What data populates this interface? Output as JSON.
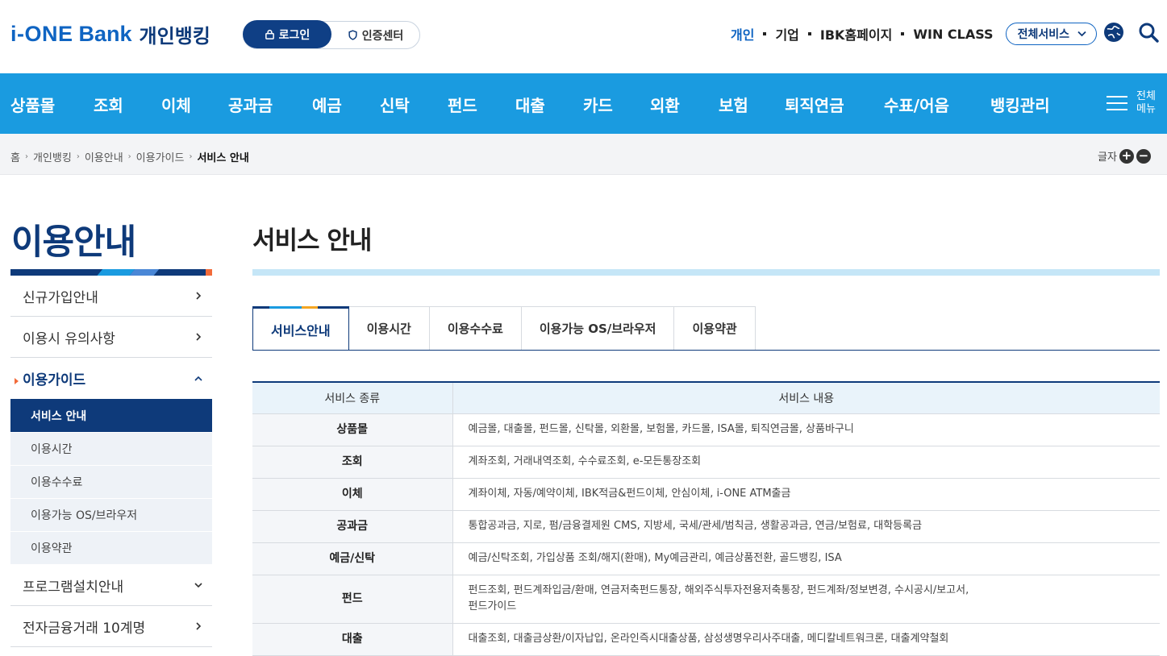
{
  "header": {
    "logo_ione": "i-ONE",
    "logo_bank": "Bank",
    "logo_kr": "개인뱅킹",
    "login_label": "로그인",
    "cert_label": "인증센터",
    "util_nav": [
      "개인",
      "기업",
      "IBK홈페이지",
      "WIN CLASS"
    ],
    "all_services_label": "전체서비스",
    "brand_color": "#0f64c2"
  },
  "gnb": {
    "items": [
      "상품몰",
      "조회",
      "이체",
      "공과금",
      "예금",
      "신탁",
      "펀드",
      "대출",
      "카드",
      "외환",
      "보험",
      "퇴직연금",
      "수표/어음",
      "뱅킹관리"
    ],
    "all_menu_label_1": "전체",
    "all_menu_label_2": "메뉴",
    "bg_color": "#1a9be0"
  },
  "breadcrumb": {
    "items": [
      "홈",
      "개인뱅킹",
      "이용안내",
      "이용가이드"
    ],
    "current": "서비스 안내",
    "font_size_label": "글자"
  },
  "lnb": {
    "title": "이용안내",
    "items": [
      {
        "label": "신규가입안내"
      },
      {
        "label": "이용시 유의사항"
      },
      {
        "label": "이용가이드"
      },
      {
        "label": "프로그램설치안내"
      },
      {
        "label": "전자금융거래 10계명"
      }
    ],
    "sub_items": [
      "서비스 안내",
      "이용시간",
      "이용수수료",
      "이용가능 OS/브라우저",
      "이용약관"
    ]
  },
  "main": {
    "page_title": "서비스 안내",
    "tabs": [
      "서비스안내",
      "이용시간",
      "이용수수료",
      "이용가능 OS/브라우저",
      "이용약관"
    ],
    "table": {
      "headers": [
        "서비스 종류",
        "서비스 내용"
      ],
      "rows": [
        {
          "kind": "상품몰",
          "content": "예금몰, 대출몰, 펀드몰, 신탁몰, 외환몰, 보험몰, 카드몰, ISA몰, 퇴직연금몰, 상품바구니"
        },
        {
          "kind": "조회",
          "content": "계좌조회, 거래내역조회, 수수료조회, e-모든통장조회"
        },
        {
          "kind": "이체",
          "content": "계좌이체, 자동/예약이체, IBK적금&펀드이체, 안심이체, i-ONE ATM출금"
        },
        {
          "kind": "공과금",
          "content": "통합공과금, 지로, 펌/금융결제원 CMS, 지방세, 국세/관세/범칙금, 생활공과금, 연금/보험료, 대학등록금"
        },
        {
          "kind": "예금/신탁",
          "content": "예금/신탁조회, 가입상품 조회/해지(환매), My예금관리, 예금상품전환, 골드뱅킹, ISA"
        },
        {
          "kind": "펀드",
          "content": "펀드조회, 펀드계좌입금/환매, 연금저축펀드통장, 해외주식투자전용저축통장, 펀드계좌/정보변경, 수시공시/보고서,",
          "content2": "펀드가이드"
        },
        {
          "kind": "대출",
          "content": "대출조회, 대출금상환/이자납입, 온라인즉시대출상품, 삼성생명우리사주대출, 메디칼네트워크론, 대출계약철회"
        }
      ]
    }
  }
}
